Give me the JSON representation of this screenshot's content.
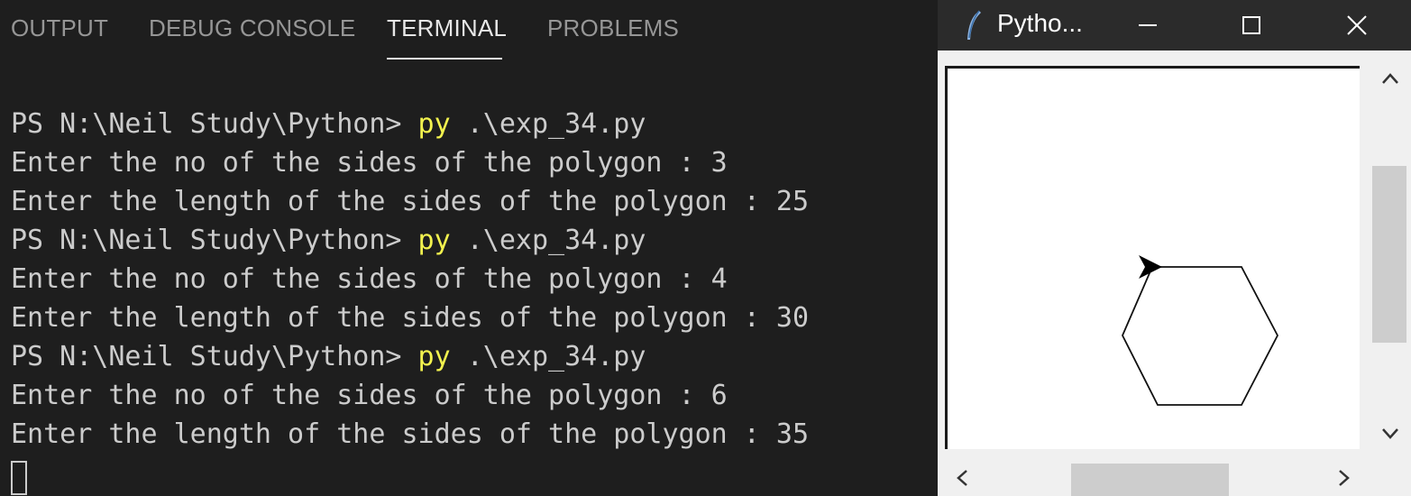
{
  "panel": {
    "tabs": [
      {
        "label": "OUTPUT",
        "active": false
      },
      {
        "label": "DEBUG CONSOLE",
        "active": false
      },
      {
        "label": "TERMINAL",
        "active": true
      },
      {
        "label": "PROBLEMS",
        "active": false
      }
    ]
  },
  "terminal": {
    "lines": [
      {
        "prompt": "PS N:\\Neil Study\\Python> ",
        "cmd": "py",
        "args": " .\\exp_34.py"
      },
      {
        "text": "Enter the no of the sides of the polygon : 3"
      },
      {
        "text": "Enter the length of the sides of the polygon : 25"
      },
      {
        "prompt": "PS N:\\Neil Study\\Python> ",
        "cmd": "py",
        "args": " .\\exp_34.py"
      },
      {
        "text": "Enter the no of the sides of the polygon : 4"
      },
      {
        "text": "Enter the length of the sides of the polygon : 30"
      },
      {
        "prompt": "PS N:\\Neil Study\\Python> ",
        "cmd": "py",
        "args": " .\\exp_34.py"
      },
      {
        "text": "Enter the no of the sides of the polygon : 6"
      },
      {
        "text": "Enter the length of the sides of the polygon : 35"
      }
    ]
  },
  "turtle_window": {
    "title": "Pytho...",
    "icons": {
      "app": "python-feather-icon",
      "minimize": "minimize-icon",
      "maximize": "maximize-icon",
      "close": "close-icon"
    },
    "canvas": {
      "shape": "hexagon",
      "sides": 6,
      "side_length": 35,
      "turtle": "arrow-cursor-icon"
    }
  },
  "colors": {
    "terminal_bg": "#1e1e1e",
    "terminal_text": "#cccccc",
    "command_yellow": "#f2f24e",
    "tab_active": "#e7e7e7",
    "tab_inactive": "#969696",
    "titlebar": "#2b2b2b"
  }
}
